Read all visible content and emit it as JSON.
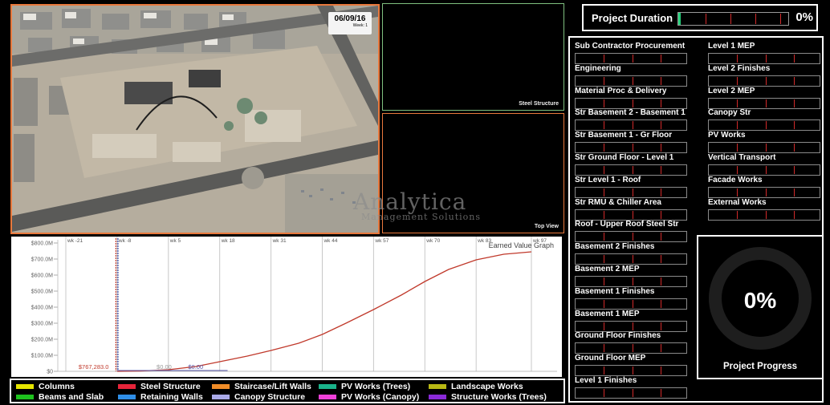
{
  "aerial": {
    "date": "06/09/16",
    "week": "Week: 1"
  },
  "panels": {
    "steel_label": "Steel Structure",
    "top_label": "Top View"
  },
  "watermark": {
    "brand": "Analytica",
    "tagline": "Management Solutions"
  },
  "chart_data": {
    "type": "line",
    "title": "Earned Value Graph",
    "x_ticks": [
      "wk -21",
      "wk -8",
      "wk 5",
      "wk 18",
      "wk 31",
      "wk 44",
      "wk 57",
      "wk 70",
      "wk 83",
      "wk 97"
    ],
    "y_ticks": [
      "$800.0M",
      "$700.0M",
      "$600.0M",
      "$500.0M",
      "$400.0M",
      "$300.0M",
      "$200.0M",
      "$100.0M",
      "$0"
    ],
    "ylim": [
      0,
      800
    ],
    "series": [
      {
        "color": "#c0392b",
        "x": [
          -8,
          -2,
          5,
          12,
          18,
          25,
          31,
          38,
          44,
          50,
          57,
          64,
          70,
          76,
          83,
          90,
          97
        ],
        "y": [
          0,
          2,
          10,
          30,
          60,
          95,
          130,
          175,
          230,
          300,
          385,
          475,
          560,
          635,
          695,
          730,
          745
        ]
      }
    ],
    "annotations": [
      "$767,283.0",
      "$0.00",
      "$0.00"
    ]
  },
  "legend": [
    {
      "label": "Columns",
      "color": "#e6e600"
    },
    {
      "label": "Beams and Slab",
      "color": "#1ec21e"
    },
    {
      "label": "Steel Structure",
      "color": "#e6243a"
    },
    {
      "label": "Retaining Walls",
      "color": "#2f8fe8"
    },
    {
      "label": "Staircase/Lift Walls",
      "color": "#f08c28"
    },
    {
      "label": "Canopy Structure",
      "color": "#a9a9e8"
    },
    {
      "label": "PV Works (Trees)",
      "color": "#1ab38a"
    },
    {
      "label": "PV Works (Canopy)",
      "color": "#f040d8"
    },
    {
      "label": "Landscape Works",
      "color": "#b8b814"
    },
    {
      "label": "Structure Works (Trees)",
      "color": "#8a2ad8"
    }
  ],
  "duration": {
    "label": "Project Duration",
    "percent": "0%",
    "value": 0.02
  },
  "tasks_left": [
    "Sub Contractor Procurement",
    "Engineering",
    "Material Proc & Delivery",
    "Str Basement 2 - Basement 1",
    "Str Basement 1 - Gr Floor",
    "Str Ground Floor - Level 1",
    "Str Level 1 - Roof",
    "Str RMU & Chiller Area",
    "Roof - Upper Roof Steel Str",
    "Basement 2 Finishes",
    "Basement 2 MEP",
    "Basement 1 Finishes",
    "Basement 1 MEP",
    "Ground Floor Finishes",
    "Ground Floor MEP",
    "Level 1 Finishes"
  ],
  "tasks_right": [
    "Level 1 MEP",
    "Level 2 Finishes",
    "Level 2 MEP",
    "Canopy Str",
    "PV Works",
    "Vertical Transport",
    "Facade Works",
    "External Works"
  ],
  "progress": {
    "percent": "0%",
    "label": "Project Progress"
  }
}
